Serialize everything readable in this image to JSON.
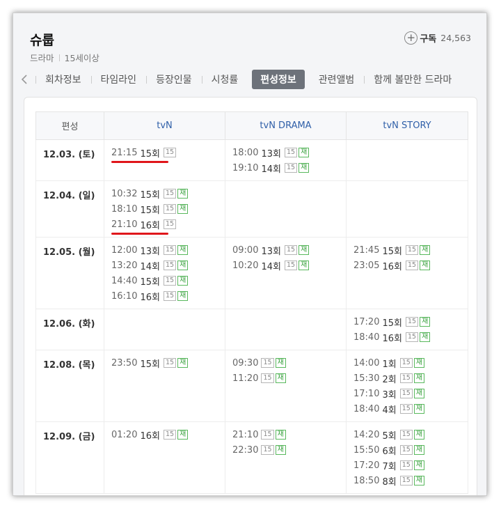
{
  "header": {
    "title": "슈룹",
    "genre": "드라마",
    "rating": "15세이상",
    "subscribe_label": "구독",
    "subscribe_count": "24,563"
  },
  "tabs": [
    "회차정보",
    "타임라인",
    "등장인물",
    "시청률",
    "편성정보",
    "관련앨범",
    "함께 볼만한 드라마"
  ],
  "active_tab": "편성정보",
  "table": {
    "headers": [
      "편성",
      "tvN",
      "tvN DRAMA",
      "tvN STORY"
    ],
    "rows": [
      {
        "date": "12.03. (토)",
        "tvn": [
          {
            "time": "21:15",
            "ep": "15회",
            "age": "15",
            "re": "",
            "highlight": true
          }
        ],
        "drama": [
          {
            "time": "18:00",
            "ep": "13회",
            "age": "15",
            "re": "재"
          },
          {
            "time": "19:10",
            "ep": "14회",
            "age": "15",
            "re": "재"
          }
        ],
        "story": []
      },
      {
        "date": "12.04. (일)",
        "tvn": [
          {
            "time": "10:32",
            "ep": "15회",
            "age": "15",
            "re": "재"
          },
          {
            "time": "18:10",
            "ep": "15회",
            "age": "15",
            "re": "재"
          },
          {
            "time": "21:10",
            "ep": "16회",
            "age": "15",
            "re": "",
            "highlight": true
          }
        ],
        "drama": [],
        "story": []
      },
      {
        "date": "12.05. (월)",
        "tvn": [
          {
            "time": "12:00",
            "ep": "13회",
            "age": "15",
            "re": "재"
          },
          {
            "time": "13:20",
            "ep": "14회",
            "age": "15",
            "re": "재"
          },
          {
            "time": "14:40",
            "ep": "15회",
            "age": "15",
            "re": "재"
          },
          {
            "time": "16:10",
            "ep": "16회",
            "age": "15",
            "re": "재"
          }
        ],
        "drama": [
          {
            "time": "09:00",
            "ep": "13회",
            "age": "15",
            "re": "재"
          },
          {
            "time": "10:20",
            "ep": "14회",
            "age": "15",
            "re": "재"
          }
        ],
        "story": [
          {
            "time": "21:45",
            "ep": "15회",
            "age": "15",
            "re": "재"
          },
          {
            "time": "23:05",
            "ep": "16회",
            "age": "15",
            "re": "재"
          }
        ]
      },
      {
        "date": "12.06. (화)",
        "tvn": [],
        "drama": [],
        "story": [
          {
            "time": "17:20",
            "ep": "15회",
            "age": "15",
            "re": "재"
          },
          {
            "time": "18:40",
            "ep": "16회",
            "age": "15",
            "re": "재"
          }
        ]
      },
      {
        "date": "12.08. (목)",
        "tvn": [
          {
            "time": "23:50",
            "ep": "15회",
            "age": "15",
            "re": "재"
          }
        ],
        "drama": [
          {
            "time": "09:30",
            "ep": "",
            "age": "15",
            "re": "재"
          },
          {
            "time": "11:20",
            "ep": "",
            "age": "15",
            "re": "재"
          }
        ],
        "story": [
          {
            "time": "14:00",
            "ep": "1회",
            "age": "15",
            "re": "재"
          },
          {
            "time": "15:30",
            "ep": "2회",
            "age": "15",
            "re": "재"
          },
          {
            "time": "17:10",
            "ep": "3회",
            "age": "15",
            "re": "재"
          },
          {
            "time": "18:40",
            "ep": "4회",
            "age": "15",
            "re": "재"
          }
        ]
      },
      {
        "date": "12.09. (금)",
        "tvn": [
          {
            "time": "01:20",
            "ep": "16회",
            "age": "15",
            "re": "재"
          }
        ],
        "drama": [
          {
            "time": "21:10",
            "ep": "",
            "age": "15",
            "re": "재"
          },
          {
            "time": "22:30",
            "ep": "",
            "age": "15",
            "re": "재"
          }
        ],
        "story": [
          {
            "time": "14:20",
            "ep": "5회",
            "age": "15",
            "re": "재"
          },
          {
            "time": "15:50",
            "ep": "6회",
            "age": "15",
            "re": "재"
          },
          {
            "time": "17:20",
            "ep": "7회",
            "age": "15",
            "re": "재"
          },
          {
            "time": "18:50",
            "ep": "8회",
            "age": "15",
            "re": "재"
          }
        ]
      }
    ]
  },
  "colors": {
    "active_tab_bg": "#6d727a",
    "channel_header": "#2f5fa8",
    "rerun_badge": "#3aa23f",
    "highlight_underline": "#e0161b"
  }
}
